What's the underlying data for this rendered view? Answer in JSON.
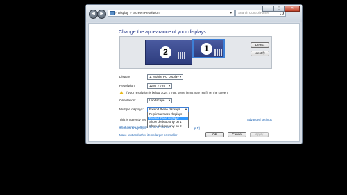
{
  "window": {
    "breadcrumb": [
      "Display",
      "Screen Resolution"
    ],
    "search_placeholder": "Search Control Panel",
    "buttons": {
      "minimize": "–",
      "maximize": "▢",
      "close": "✕"
    }
  },
  "heading": "Change the appearance of your displays",
  "monitors": {
    "primary": "1",
    "secondary": "2"
  },
  "buttons": {
    "detect": "Detect",
    "identify": "Identify",
    "ok": "OK",
    "cancel": "Cancel",
    "apply": "Apply"
  },
  "fields": {
    "display": {
      "label": "Display:",
      "value": "1. Mobile PC Display"
    },
    "resolution": {
      "label": "Resolution:",
      "value": "1280 × 720"
    },
    "orientation": {
      "label": "Orientation:",
      "value": "Landscape"
    },
    "multiple": {
      "label": "Multiple displays:",
      "value": "Extend these displays"
    }
  },
  "warning": "If your resolution is below 1024 x 768, some items may not fit on the screen.",
  "dropdown": {
    "options": [
      "Duplicate these displays",
      "Extend these displays",
      "Show desktop only on 1",
      "Show desktop only on 2"
    ],
    "selected_index": 1
  },
  "current_text": "This is currently you",
  "advanced_link": "Advanced settings",
  "links": {
    "projector": "Connect to a proje",
    "projector_tail": "p P)",
    "text_size": "Make text and other items larger or smaller",
    "which_settings": "What display settings should I choose?"
  }
}
